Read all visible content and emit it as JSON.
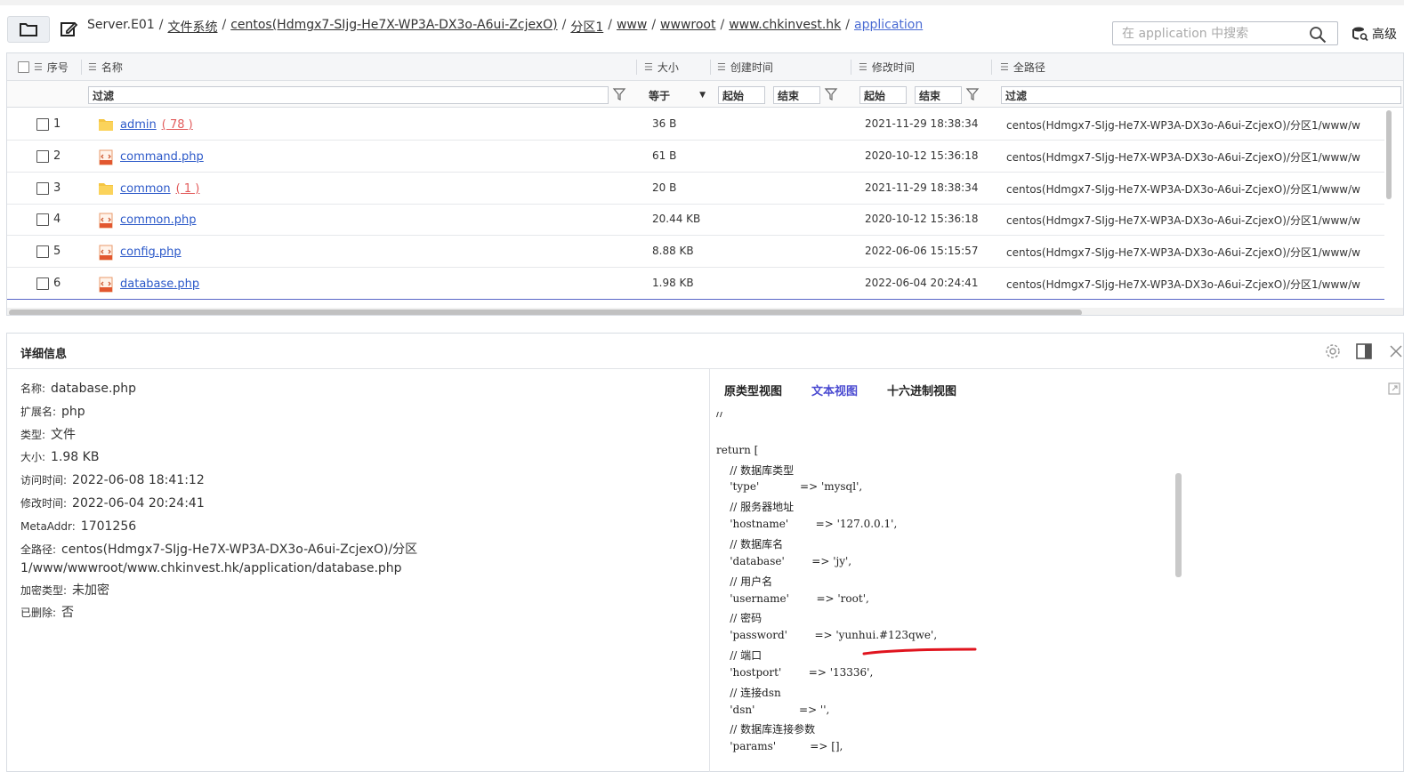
{
  "toolbar": {
    "breadcrumb": [
      {
        "label": "Server.E01",
        "plain": true
      },
      {
        "label": "文件系统"
      },
      {
        "label": "centos(Hdmgx7-SIjg-He7X-WP3A-DX3o-A6ui-ZcjexO)"
      },
      {
        "label": "分区1"
      },
      {
        "label": "www"
      },
      {
        "label": "wwwroot"
      },
      {
        "label": "www.chkinvest.hk"
      },
      {
        "label": "application",
        "current": true
      }
    ],
    "search_placeholder": "在 application 中搜索",
    "advanced_label": "高级"
  },
  "table": {
    "headers": {
      "index": "序号",
      "name": "名称",
      "size": "大小",
      "created": "创建时间",
      "modified": "修改时间",
      "fullpath": "全路径"
    },
    "filters": {
      "name": "过滤",
      "size_op": "等于",
      "created_start": "起始",
      "created_end": "结束",
      "modified_start": "起始",
      "modified_end": "结束",
      "path": "过滤"
    },
    "rows": [
      {
        "idx": "1",
        "type": "folder",
        "name": "admin",
        "count": "( 78 )",
        "size": "36 B",
        "modified": "2021-11-29 18:38:34",
        "path": "centos(Hdmgx7-SIjg-He7X-WP3A-DX3o-A6ui-ZcjexO)/分区1/www/w"
      },
      {
        "idx": "2",
        "type": "php",
        "name": "command.php",
        "count": "",
        "size": "61 B",
        "modified": "2020-10-12 15:36:18",
        "path": "centos(Hdmgx7-SIjg-He7X-WP3A-DX3o-A6ui-ZcjexO)/分区1/www/w"
      },
      {
        "idx": "3",
        "type": "folder",
        "name": "common",
        "count": "( 1 )",
        "size": "20 B",
        "modified": "2021-11-29 18:38:34",
        "path": "centos(Hdmgx7-SIjg-He7X-WP3A-DX3o-A6ui-ZcjexO)/分区1/www/w"
      },
      {
        "idx": "4",
        "type": "php",
        "name": "common.php",
        "count": "",
        "size": "20.44 KB",
        "modified": "2020-10-12 15:36:18",
        "path": "centos(Hdmgx7-SIjg-He7X-WP3A-DX3o-A6ui-ZcjexO)/分区1/www/w"
      },
      {
        "idx": "5",
        "type": "php",
        "name": "config.php",
        "count": "",
        "size": "8.88 KB",
        "modified": "2022-06-06 15:15:57",
        "path": "centos(Hdmgx7-SIjg-He7X-WP3A-DX3o-A6ui-ZcjexO)/分区1/www/w"
      },
      {
        "idx": "6",
        "type": "php",
        "name": "database.php",
        "count": "",
        "size": "1.98 KB",
        "modified": "2022-06-04 20:24:41",
        "path": "centos(Hdmgx7-SIjg-He7X-WP3A-DX3o-A6ui-ZcjexO)/分区1/www/w",
        "selected": true
      }
    ]
  },
  "detail": {
    "title": "详细信息",
    "props": [
      {
        "k": "名称:",
        "v": "database.php"
      },
      {
        "k": "扩展名:",
        "v": "php"
      },
      {
        "k": "类型:",
        "v": "文件"
      },
      {
        "k": "大小:",
        "v": "1.98 KB"
      },
      {
        "k": "访问时间:",
        "v": "2022-06-08 18:41:12"
      },
      {
        "k": "修改时间:",
        "v": "2022-06-04 20:24:41"
      },
      {
        "k": "MetaAddr:",
        "v": "1701256"
      }
    ],
    "fullpath_key": "全路径:",
    "fullpath_line1": "centos(Hdmgx7-SIjg-He7X-WP3A-DX3o-A6ui-ZcjexO)/分区",
    "fullpath_line2": "1/www/wwwroot/www.chkinvest.hk/application/database.php",
    "props2": [
      {
        "k": "加密类型:",
        "v": "未加密"
      },
      {
        "k": "已删除:",
        "v": "否"
      }
    ],
    "tabs": [
      "原类型视图",
      "文本视图",
      "十六进制视图"
    ],
    "active_tab": 1,
    "code_lines": [
      "// '",
      "",
      "return [",
      "    // 数据库类型",
      "    'type'            => 'mysql',",
      "    // 服务器地址",
      "    'hostname'        => '127.0.0.1',",
      "    // 数据库名",
      "    'database'        => 'jy',",
      "    // 用户名",
      "    'username'        => 'root',",
      "    // 密码",
      "    'password'        => 'yunhui.#123qwe',",
      "    // 端口",
      "    'hostport'        => '13336',",
      "    // 连接dsn",
      "    'dsn'             => '',",
      "    // 数据库连接参数",
      "    'params'          => [],"
    ]
  },
  "colors": {
    "link": "#2c59c9",
    "accent": "#4a4ad1",
    "count": "#e25c5c",
    "annotation": "#e0141e"
  }
}
